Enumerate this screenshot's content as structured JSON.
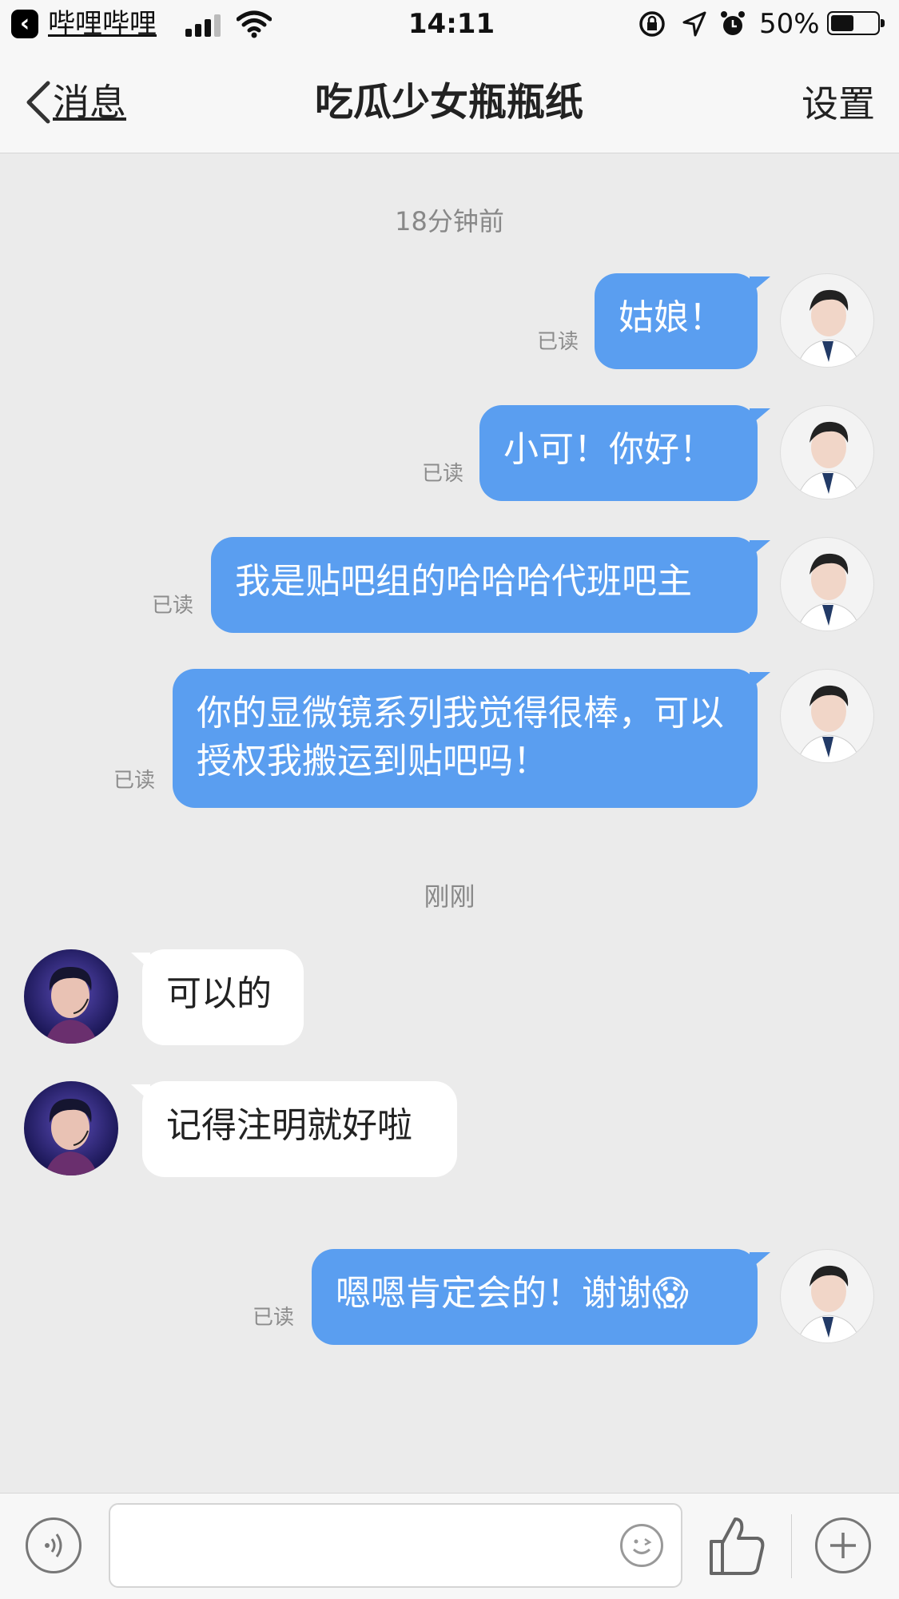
{
  "status_bar": {
    "back_app": "哔哩哔哩",
    "time": "14:11",
    "battery_percent": "50%"
  },
  "nav": {
    "back_label": "消息",
    "title": "吃瓜少女瓶瓶纸",
    "settings_label": "设置"
  },
  "timestamps": [
    "18分钟前",
    "刚刚"
  ],
  "messages": [
    {
      "direction": "out",
      "text": "姑娘！",
      "read": "已读"
    },
    {
      "direction": "out",
      "text": "小可！你好！",
      "read": "已读"
    },
    {
      "direction": "out",
      "text": "我是贴吧组的哈哈哈代班吧主",
      "read": "已读"
    },
    {
      "direction": "out",
      "text": "你的显微镜系列我觉得很棒，可以授权我搬运到贴吧吗！",
      "read": "已读"
    },
    {
      "direction": "in",
      "text": "可以的"
    },
    {
      "direction": "in",
      "text": "记得注明就好啦"
    },
    {
      "direction": "out",
      "text": "嗯嗯肯定会的！谢谢😱",
      "read": "已读"
    }
  ],
  "input": {
    "placeholder": ""
  },
  "icons": {
    "voice": "voice-icon",
    "emoji": "emoji-icon",
    "like": "thumbs-up-icon",
    "plus": "plus-icon"
  },
  "colors": {
    "outgoing_bubble": "#5a9ef0",
    "incoming_bubble": "#ffffff",
    "background": "#ebebeb"
  }
}
